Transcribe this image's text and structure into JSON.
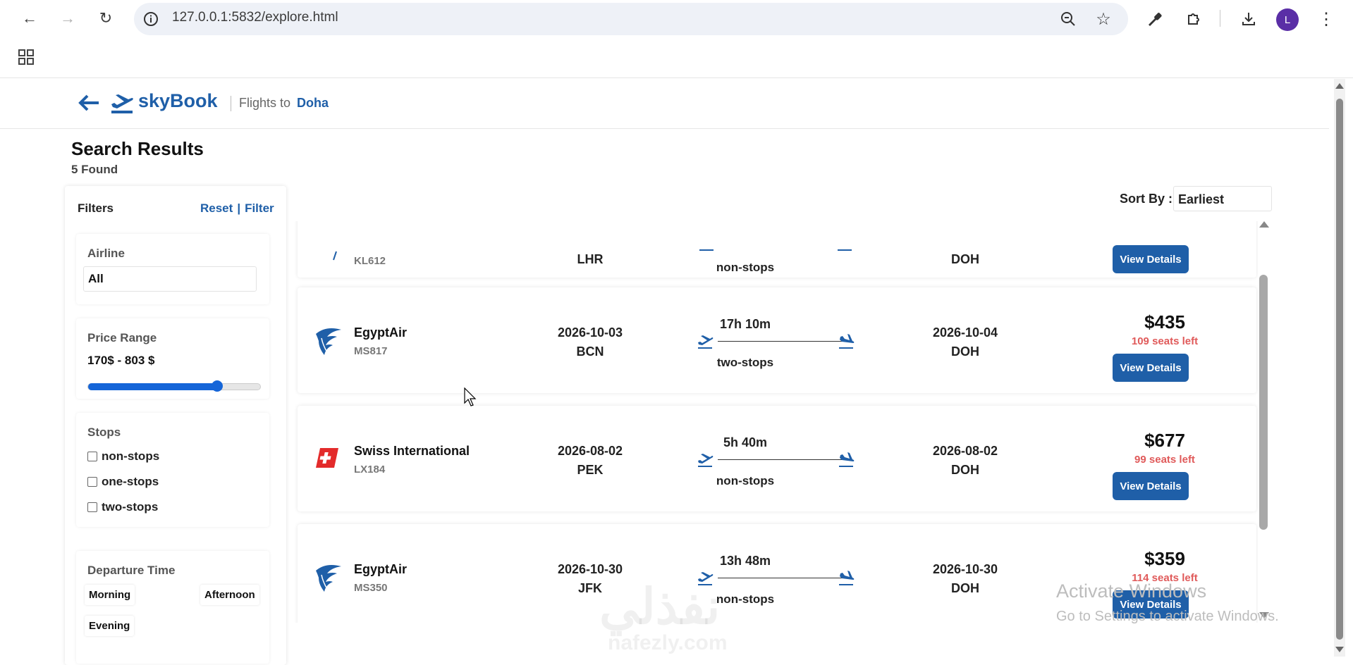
{
  "browser": {
    "url": "127.0.0.1:5832/explore.html",
    "avatar_letter": "L"
  },
  "header": {
    "brand": "skyBook",
    "flights_to_label": "Flights to",
    "destination": "Doha"
  },
  "results": {
    "title": "Search Results",
    "count": "5 Found"
  },
  "filters": {
    "title": "Filters",
    "reset_label": "Reset",
    "separator": "|",
    "filter_label": "Filter",
    "airline_label": "Airline",
    "airline_value": "All",
    "price_label": "Price Range",
    "price_value": "170$ - 803 $",
    "price_slider_fraction": 0.75,
    "stops_label": "Stops",
    "stops_options": [
      "non-stops",
      "one-stops",
      "two-stops"
    ],
    "departure_label": "Departure Time",
    "departure_options": [
      "Morning",
      "Afternoon",
      "Evening"
    ]
  },
  "sort": {
    "label": "Sort By :",
    "value": "Earliest"
  },
  "flights": [
    {
      "airline": "",
      "flight_no": "KL612",
      "dep_date": "",
      "dep_code": "LHR",
      "duration": "",
      "stops": "non-stops",
      "arr_date": "",
      "arr_code": "DOH",
      "price": "",
      "seats": "",
      "button": "View Details",
      "logo": "klm-logo"
    },
    {
      "airline": "EgyptAir",
      "flight_no": "MS817",
      "dep_date": "2026-10-03",
      "dep_code": "BCN",
      "duration": "17h 10m",
      "stops": "two-stops",
      "arr_date": "2026-10-04",
      "arr_code": "DOH",
      "price": "$435",
      "seats": "109 seats left",
      "button": "View Details",
      "logo": "egyptair-logo"
    },
    {
      "airline": "Swiss International",
      "flight_no": "LX184",
      "dep_date": "2026-08-02",
      "dep_code": "PEK",
      "duration": "5h 40m",
      "stops": "non-stops",
      "arr_date": "2026-08-02",
      "arr_code": "DOH",
      "price": "$677",
      "seats": "99 seats left",
      "button": "View Details",
      "logo": "swiss-logo"
    },
    {
      "airline": "EgyptAir",
      "flight_no": "MS350",
      "dep_date": "2026-10-30",
      "dep_code": "JFK",
      "duration": "13h 48m",
      "stops": "non-stops",
      "arr_date": "2026-10-30",
      "arr_code": "DOH",
      "price": "$359",
      "seats": "114 seats left",
      "button": "View Details",
      "logo": "egyptair-logo"
    }
  ],
  "overlay": {
    "activate_title": "Activate Windows",
    "activate_sub": "Go to Settings to activate Windows.",
    "site_logo_ar": "نفذلي",
    "site_logo_en": "nafezly.com"
  },
  "colors": {
    "brand": "#1f5fa8",
    "seats": "#e05a5a"
  }
}
